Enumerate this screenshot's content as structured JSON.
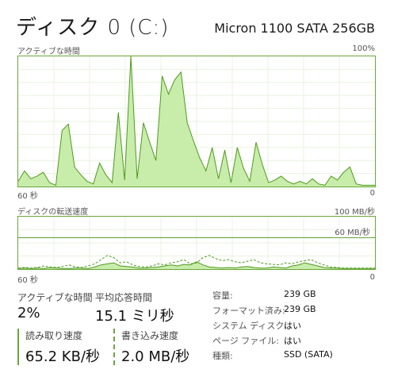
{
  "title": "ディスク 0 (C:)",
  "model": "Micron 1100 SATA 256GB",
  "activity": {
    "label": "アクティブな時間",
    "max": "100%",
    "time": "60 秒",
    "min": "0",
    "points": [
      4,
      12,
      6,
      8,
      11,
      3,
      1,
      43,
      48,
      15,
      9,
      4,
      2,
      18,
      9,
      3,
      57,
      5,
      100,
      6,
      49,
      34,
      20,
      85,
      71,
      82,
      88,
      49,
      35,
      22,
      12,
      30,
      6,
      28,
      3,
      30,
      14,
      4,
      34,
      17,
      3,
      5,
      8,
      4,
      2,
      4,
      2,
      6,
      2,
      1,
      8,
      5,
      11,
      15,
      2,
      1,
      1,
      1
    ]
  },
  "transfer": {
    "label": "ディスクの転送速度",
    "max": "100 MB/秒",
    "ref_label": "60 MB/秒",
    "ref_value": 60,
    "time": "60 秒",
    "min": "0",
    "read_points": [
      1,
      2,
      1,
      2,
      1,
      3,
      2,
      1,
      1,
      2,
      2,
      1,
      4,
      8,
      10,
      12,
      6,
      5,
      4,
      2,
      2,
      3,
      4,
      6,
      8,
      6,
      9,
      8,
      14,
      8,
      4,
      3,
      2,
      3,
      2,
      4,
      5,
      3,
      2,
      2,
      4,
      3,
      2,
      6,
      8,
      12,
      9,
      6,
      3,
      2,
      2,
      1,
      1,
      1,
      1,
      1,
      1
    ],
    "write_points": [
      2,
      3,
      2,
      3,
      6,
      4,
      3,
      5,
      8,
      4,
      3,
      6,
      10,
      18,
      26,
      22,
      12,
      14,
      8,
      5,
      4,
      6,
      10,
      8,
      12,
      14,
      18,
      10,
      12,
      22,
      26,
      20,
      16,
      18,
      14,
      12,
      15,
      18,
      12,
      10,
      9,
      8,
      12,
      10,
      14,
      16,
      18,
      12,
      8,
      4,
      3,
      2,
      2,
      2,
      2,
      2,
      2
    ]
  },
  "stats": {
    "active_label": "アクティブな時間",
    "active_value": "2%",
    "resp_label": "平均応答時間",
    "resp_value": "15.1 ミリ秒",
    "read_label": "読み取り速度",
    "read_value": "65.2 KB/秒",
    "write_label": "書き込み速度",
    "write_value": "2.0 MB/秒"
  },
  "properties": [
    {
      "key": "容量:",
      "value": "239 GB"
    },
    {
      "key": "フォーマット済み:",
      "value": "239 GB"
    },
    {
      "key": "システム ディスク:",
      "value": "はい"
    },
    {
      "key": "ページ ファイル:",
      "value": "はい"
    },
    {
      "key": "種類:",
      "value": "SSD (SATA)"
    }
  ],
  "colors": {
    "line": "#4f9a1f",
    "fill": "#c8ecaa",
    "grid": "#e9f3df",
    "border": "#6aa73a"
  }
}
